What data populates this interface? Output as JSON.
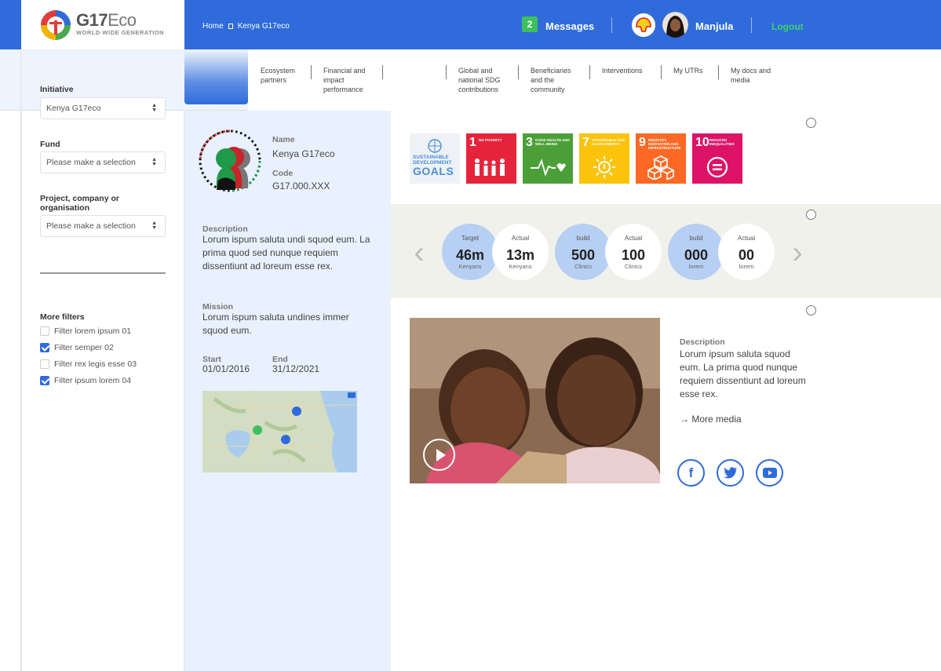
{
  "brand": {
    "name_main": "G17",
    "name_suffix": "Eco",
    "tagline": "WORLD WIDE GENERATION",
    "primary_color": "#2f6bdb",
    "accent_green": "#3dbf5e"
  },
  "breadcrumb": {
    "home": "Home",
    "current": "Kenya G17eco"
  },
  "header": {
    "messages_count": "2",
    "messages_label": "Messages",
    "user_name": "Manjula",
    "logout_label": "Logout"
  },
  "nav": {
    "items": [
      "Ecosystem\npartners",
      "Financial and\nimpact\nperformance",
      "Global and\nnational SDG\ncontributions",
      "Beneficiaries\nand the\ncommunity",
      "Interventions",
      "My UTRs",
      "My docs and\nmedia"
    ]
  },
  "sidebar": {
    "initiative_label": "Initiative",
    "initiative_value": "Kenya G17eco",
    "fund_label": "Fund",
    "fund_value": "Please make a selection",
    "project_label": "Project, company or\norganisation",
    "project_value": "Please make a selection",
    "more_filters_label": "More filters",
    "filters": [
      {
        "label": "Filter lorem ipsum 01",
        "checked": false
      },
      {
        "label": "Filter semper 02",
        "checked": true
      },
      {
        "label": "Filter rex legis esse 03",
        "checked": false
      },
      {
        "label": "Filter ipsum lorem 04",
        "checked": true
      }
    ]
  },
  "info": {
    "name_label": "Name",
    "name_value": "Kenya G17eco",
    "code_label": "Code",
    "code_value": "G17.000.XXX",
    "description_label": "Description",
    "description_value": "Lorum ispum saluta undi squod eum. La prima quod sed nunque requiem dissentiunt ad loreum esse rex.",
    "mission_label": "Mission",
    "mission_value": "Lorum ispum saluta undines immer squod eum.",
    "start_label": "Start",
    "start_value": "01/01/2016",
    "end_label": "End",
    "end_value": "31/12/2021"
  },
  "sdgs": [
    {
      "num": "1",
      "text": "NO POVERTY",
      "color": "#e5243b",
      "icon": "people-icon"
    },
    {
      "num": "3",
      "text": "GOOD HEALTH AND WELL-BEING",
      "color": "#4c9f38",
      "icon": "heartbeat-icon"
    },
    {
      "num": "7",
      "text": "AFFORDABLE AND CLEAN ENERGY",
      "color": "#fcc30b",
      "icon": "sun-icon"
    },
    {
      "num": "9",
      "text": "INDUSTRY, INNOVATION AND INFRASTRUCTURE",
      "color": "#fd6925",
      "icon": "cubes-icon"
    },
    {
      "num": "10",
      "text": "REDUCED INEQUALITIES",
      "color": "#dd1367",
      "icon": "equal-icon"
    }
  ],
  "sdg_goals": {
    "line1": "SUSTAINABLE",
    "line2": "DEVELOPMENT",
    "line3": "GOALS"
  },
  "stats": [
    {
      "label": "Target",
      "value": "46m",
      "unit": "Kenyans",
      "kind": "target"
    },
    {
      "label": "Actual",
      "value": "13m",
      "unit": "Kenyans",
      "kind": "actual"
    },
    {
      "label": "build",
      "value": "500",
      "unit": "Clinics",
      "kind": "target"
    },
    {
      "label": "Actual",
      "value": "100",
      "unit": "Clinics",
      "kind": "actual"
    },
    {
      "label": "build",
      "value": "000",
      "unit": "lorem",
      "kind": "target"
    },
    {
      "label": "Actual",
      "value": "00",
      "unit": "lorem",
      "kind": "actual"
    }
  ],
  "media": {
    "description_label": "Description",
    "description_value": "Lorum ipsum saluta squod eum. La prima quod nunque requiem dissentiunt ad loreum esse rex.",
    "more_media": "→ More media"
  }
}
